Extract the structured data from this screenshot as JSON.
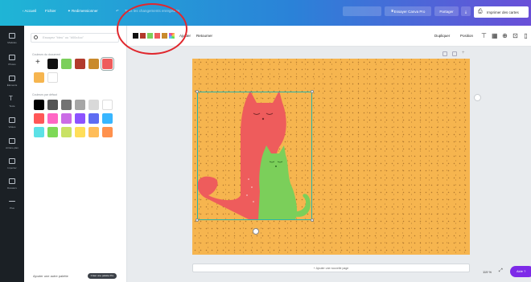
{
  "topbar": {
    "home": "Accueil",
    "file": "Fichier",
    "resize": "Redimensionner",
    "doc_title": "",
    "saved": "Tous les changements enregistrés",
    "upgrade": "Essayer Canva Pro",
    "share": "Partager",
    "print": "Imprimer des cartes"
  },
  "rail": {
    "items": [
      {
        "label": "Modèles",
        "icon": "templates-icon"
      },
      {
        "label": "Photos",
        "icon": "photos-icon"
      },
      {
        "label": "Éléments",
        "icon": "elements-icon"
      },
      {
        "label": "Texte",
        "icon": "text-icon"
      },
      {
        "label": "Vidéos",
        "icon": "video-icon"
      },
      {
        "label": "Arrière-plan",
        "icon": "background-icon"
      },
      {
        "label": "Importer",
        "icon": "upload-icon"
      },
      {
        "label": "Dossiers",
        "icon": "folder-icon"
      },
      {
        "label": "Plus",
        "icon": "more-icon"
      }
    ]
  },
  "panel": {
    "search_placeholder": "Essayez \"bleu\" ou \"#00c4cc\"",
    "doc_colors_title": "Couleurs du document",
    "doc_colors": [
      "#111111",
      "#7bcf5a",
      "#b23a2b",
      "#c98a2b",
      "#ee5c5c",
      "#f6b54f",
      "#ffffff"
    ],
    "default_colors_title": "Couleurs par défaut",
    "default_colors": [
      "#000000",
      "#555555",
      "#737373",
      "#a6a6a6",
      "#d9d9d9",
      "#ffffff",
      "#ff5757",
      "#ff66c4",
      "#cb6ce6",
      "#8c52ff",
      "#5e6cf2",
      "#38b6ff",
      "#5ce1e6",
      "#7ed957",
      "#c9e265",
      "#ffde59",
      "#ffbd59",
      "#ff914d"
    ],
    "footer_text": "Ajouter une autre palette",
    "footer_btn": "Créer une palette Pro"
  },
  "toolbar": {
    "swatches": [
      "#111111",
      "#b23a2b",
      "#7bcf5a",
      "#ee5c5c",
      "#c98a2b"
    ],
    "flip": "Ajuster",
    "flip2": "Retourner",
    "duplicate": "Dupliquer",
    "position": "Position"
  },
  "canvas": {
    "add_page": "+ Ajouter une nouvelle page",
    "zoom": "119 %",
    "help_btn": "Aide ?"
  },
  "colors": {
    "page_bg": "#f6b54f",
    "cat_red": "#ee5c5c",
    "cat_green": "#7bcf5a",
    "selection": "#28b4a8"
  }
}
